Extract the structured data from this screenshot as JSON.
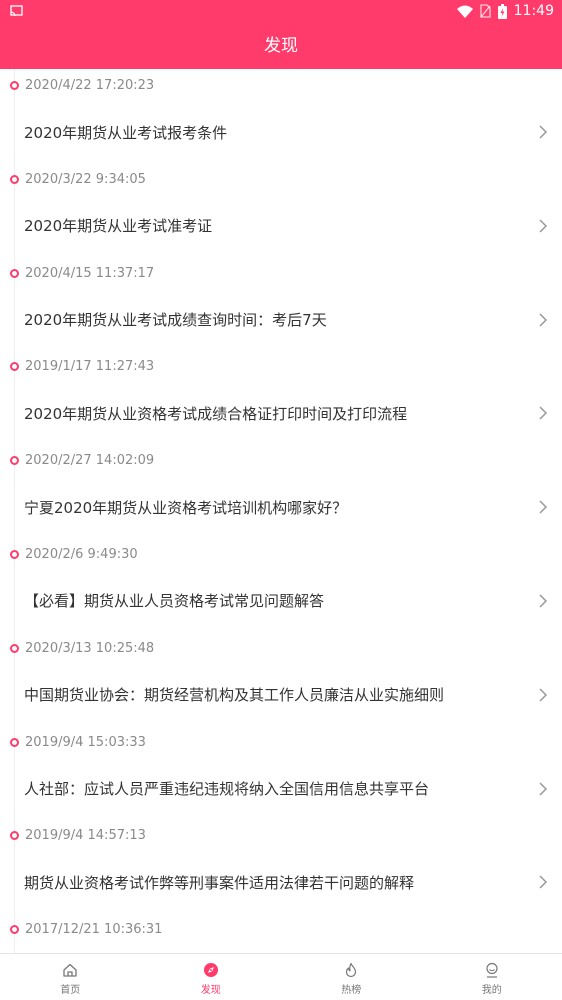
{
  "status_bar": {
    "time": "11:49"
  },
  "header": {
    "title": "发现"
  },
  "entries": [
    {
      "date": "2020/4/22 17:20:23",
      "title": "2020年期货从业考试报考条件"
    },
    {
      "date": "2020/3/22 9:34:05",
      "title": "2020年期货从业考试准考证"
    },
    {
      "date": "2020/4/15 11:37:17",
      "title": "2020年期货从业考试成绩查询时间：考后7天"
    },
    {
      "date": "2019/1/17 11:27:43",
      "title": "2020年期货从业资格考试成绩合格证打印时间及打印流程"
    },
    {
      "date": "2020/2/27 14:02:09",
      "title": "宁夏2020年期货从业资格考试培训机构哪家好？"
    },
    {
      "date": "2020/2/6 9:49:30",
      "title": "【必看】期货从业人员资格考试常见问题解答"
    },
    {
      "date": "2020/3/13 10:25:48",
      "title": "中国期货业协会：期货经营机构及其工作人员廉洁从业实施细则"
    },
    {
      "date": "2019/9/4 15:03:33",
      "title": "人社部：应试人员严重违纪违规将纳入全国信用信息共享平台"
    },
    {
      "date": "2019/9/4 14:57:13",
      "title": "期货从业资格考试作弊等刑事案件适用法律若干问题的解释"
    },
    {
      "date": "2017/12/21 10:36:31",
      "title": ""
    }
  ],
  "tabbar": {
    "items": [
      {
        "label": "首页",
        "icon": "home-icon"
      },
      {
        "label": "发现",
        "icon": "compass-icon"
      },
      {
        "label": "热榜",
        "icon": "flame-icon"
      },
      {
        "label": "我的",
        "icon": "user-icon"
      }
    ],
    "active_index": 1
  },
  "colors": {
    "accent": "#ff3b6b"
  }
}
